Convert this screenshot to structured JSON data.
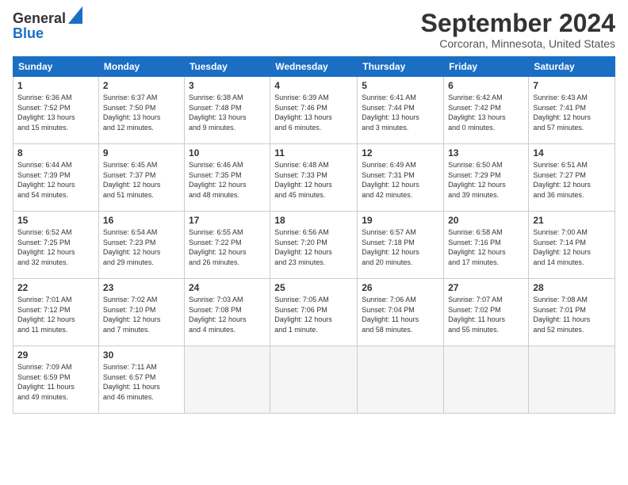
{
  "header": {
    "logo_line1": "General",
    "logo_line2": "Blue",
    "title": "September 2024",
    "location": "Corcoran, Minnesota, United States"
  },
  "calendar": {
    "headers": [
      "Sunday",
      "Monday",
      "Tuesday",
      "Wednesday",
      "Thursday",
      "Friday",
      "Saturday"
    ],
    "weeks": [
      [
        {
          "day": "1",
          "detail": "Sunrise: 6:36 AM\nSunset: 7:52 PM\nDaylight: 13 hours\nand 15 minutes."
        },
        {
          "day": "2",
          "detail": "Sunrise: 6:37 AM\nSunset: 7:50 PM\nDaylight: 13 hours\nand 12 minutes."
        },
        {
          "day": "3",
          "detail": "Sunrise: 6:38 AM\nSunset: 7:48 PM\nDaylight: 13 hours\nand 9 minutes."
        },
        {
          "day": "4",
          "detail": "Sunrise: 6:39 AM\nSunset: 7:46 PM\nDaylight: 13 hours\nand 6 minutes."
        },
        {
          "day": "5",
          "detail": "Sunrise: 6:41 AM\nSunset: 7:44 PM\nDaylight: 13 hours\nand 3 minutes."
        },
        {
          "day": "6",
          "detail": "Sunrise: 6:42 AM\nSunset: 7:42 PM\nDaylight: 13 hours\nand 0 minutes."
        },
        {
          "day": "7",
          "detail": "Sunrise: 6:43 AM\nSunset: 7:41 PM\nDaylight: 12 hours\nand 57 minutes."
        }
      ],
      [
        {
          "day": "8",
          "detail": "Sunrise: 6:44 AM\nSunset: 7:39 PM\nDaylight: 12 hours\nand 54 minutes."
        },
        {
          "day": "9",
          "detail": "Sunrise: 6:45 AM\nSunset: 7:37 PM\nDaylight: 12 hours\nand 51 minutes."
        },
        {
          "day": "10",
          "detail": "Sunrise: 6:46 AM\nSunset: 7:35 PM\nDaylight: 12 hours\nand 48 minutes."
        },
        {
          "day": "11",
          "detail": "Sunrise: 6:48 AM\nSunset: 7:33 PM\nDaylight: 12 hours\nand 45 minutes."
        },
        {
          "day": "12",
          "detail": "Sunrise: 6:49 AM\nSunset: 7:31 PM\nDaylight: 12 hours\nand 42 minutes."
        },
        {
          "day": "13",
          "detail": "Sunrise: 6:50 AM\nSunset: 7:29 PM\nDaylight: 12 hours\nand 39 minutes."
        },
        {
          "day": "14",
          "detail": "Sunrise: 6:51 AM\nSunset: 7:27 PM\nDaylight: 12 hours\nand 36 minutes."
        }
      ],
      [
        {
          "day": "15",
          "detail": "Sunrise: 6:52 AM\nSunset: 7:25 PM\nDaylight: 12 hours\nand 32 minutes."
        },
        {
          "day": "16",
          "detail": "Sunrise: 6:54 AM\nSunset: 7:23 PM\nDaylight: 12 hours\nand 29 minutes."
        },
        {
          "day": "17",
          "detail": "Sunrise: 6:55 AM\nSunset: 7:22 PM\nDaylight: 12 hours\nand 26 minutes."
        },
        {
          "day": "18",
          "detail": "Sunrise: 6:56 AM\nSunset: 7:20 PM\nDaylight: 12 hours\nand 23 minutes."
        },
        {
          "day": "19",
          "detail": "Sunrise: 6:57 AM\nSunset: 7:18 PM\nDaylight: 12 hours\nand 20 minutes."
        },
        {
          "day": "20",
          "detail": "Sunrise: 6:58 AM\nSunset: 7:16 PM\nDaylight: 12 hours\nand 17 minutes."
        },
        {
          "day": "21",
          "detail": "Sunrise: 7:00 AM\nSunset: 7:14 PM\nDaylight: 12 hours\nand 14 minutes."
        }
      ],
      [
        {
          "day": "22",
          "detail": "Sunrise: 7:01 AM\nSunset: 7:12 PM\nDaylight: 12 hours\nand 11 minutes."
        },
        {
          "day": "23",
          "detail": "Sunrise: 7:02 AM\nSunset: 7:10 PM\nDaylight: 12 hours\nand 7 minutes."
        },
        {
          "day": "24",
          "detail": "Sunrise: 7:03 AM\nSunset: 7:08 PM\nDaylight: 12 hours\nand 4 minutes."
        },
        {
          "day": "25",
          "detail": "Sunrise: 7:05 AM\nSunset: 7:06 PM\nDaylight: 12 hours\nand 1 minute."
        },
        {
          "day": "26",
          "detail": "Sunrise: 7:06 AM\nSunset: 7:04 PM\nDaylight: 11 hours\nand 58 minutes."
        },
        {
          "day": "27",
          "detail": "Sunrise: 7:07 AM\nSunset: 7:02 PM\nDaylight: 11 hours\nand 55 minutes."
        },
        {
          "day": "28",
          "detail": "Sunrise: 7:08 AM\nSunset: 7:01 PM\nDaylight: 11 hours\nand 52 minutes."
        }
      ],
      [
        {
          "day": "29",
          "detail": "Sunrise: 7:09 AM\nSunset: 6:59 PM\nDaylight: 11 hours\nand 49 minutes."
        },
        {
          "day": "30",
          "detail": "Sunrise: 7:11 AM\nSunset: 6:57 PM\nDaylight: 11 hours\nand 46 minutes."
        },
        {
          "day": "",
          "detail": ""
        },
        {
          "day": "",
          "detail": ""
        },
        {
          "day": "",
          "detail": ""
        },
        {
          "day": "",
          "detail": ""
        },
        {
          "day": "",
          "detail": ""
        }
      ]
    ]
  }
}
